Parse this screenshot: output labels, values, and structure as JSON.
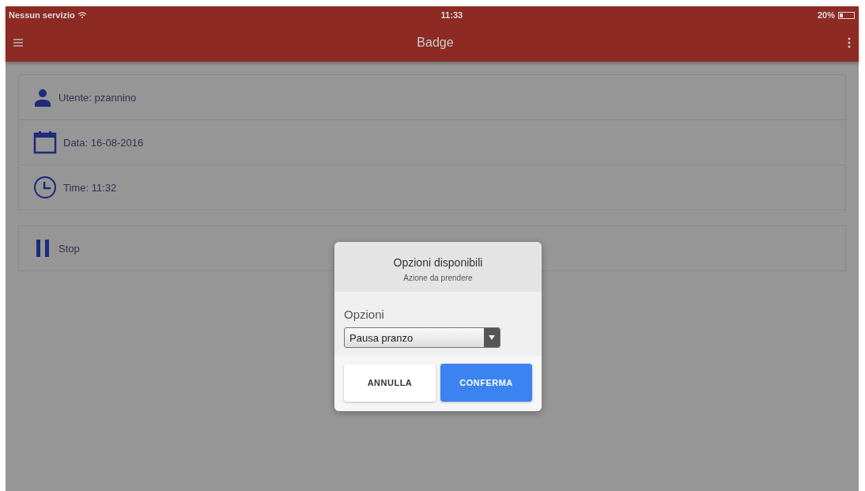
{
  "status_bar": {
    "carrier": "Nessun servizio",
    "time": "11:33",
    "battery": "20%"
  },
  "app_bar": {
    "title": "Badge"
  },
  "info_items": [
    {
      "kind": "user",
      "label": "Utente: pzannino"
    },
    {
      "kind": "calendar",
      "label": "Data: 16-08-2016"
    },
    {
      "kind": "clock",
      "label": "Time: 11:32"
    }
  ],
  "action_item": {
    "kind": "pause",
    "label": "Stop"
  },
  "dialog": {
    "title": "Opzioni disponibili",
    "subtitle": "Azione da prendere",
    "field_label": "Opzioni",
    "select_value": "Pausa pranzo",
    "buttons": [
      {
        "label": "ANNULLA",
        "kind": "secondary"
      },
      {
        "label": "CONFERMA",
        "kind": "primary"
      }
    ]
  }
}
